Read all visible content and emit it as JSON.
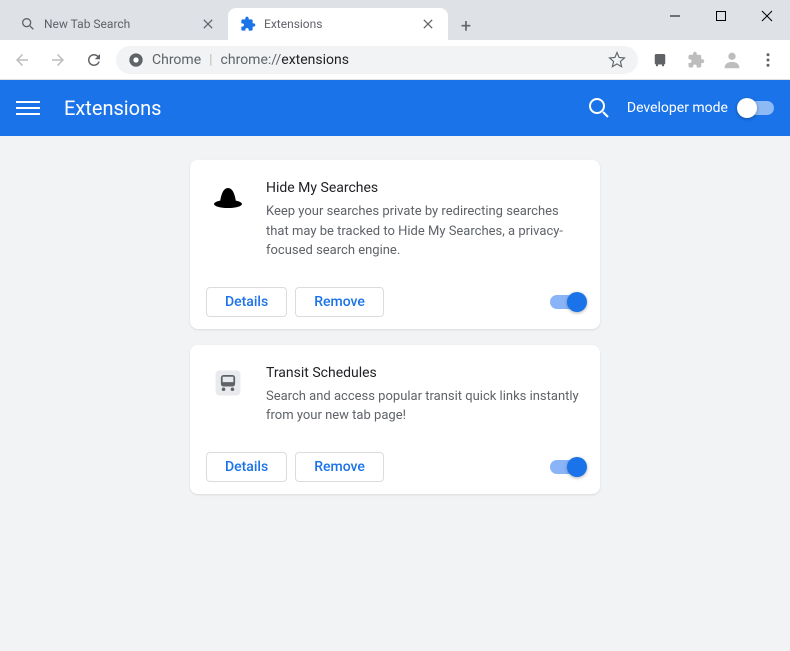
{
  "window": {
    "tabs": [
      {
        "title": "New Tab Search",
        "active": false
      },
      {
        "title": "Extensions",
        "active": true
      }
    ]
  },
  "toolbar": {
    "url_prefix": "Chrome",
    "url_protocol": "chrome://",
    "url_path": "extensions"
  },
  "header": {
    "title": "Extensions",
    "dev_mode_label": "Developer mode",
    "dev_mode_on": false
  },
  "buttons": {
    "details": "Details",
    "remove": "Remove"
  },
  "extensions": [
    {
      "name": "Hide My Searches",
      "description": "Keep your searches private by redirecting searches that may be tracked to Hide My Searches, a privacy-focused search engine.",
      "enabled": true,
      "icon": "hat"
    },
    {
      "name": "Transit Schedules",
      "description": "Search and access popular transit quick links instantly from your new tab page!",
      "enabled": true,
      "icon": "bus"
    }
  ]
}
